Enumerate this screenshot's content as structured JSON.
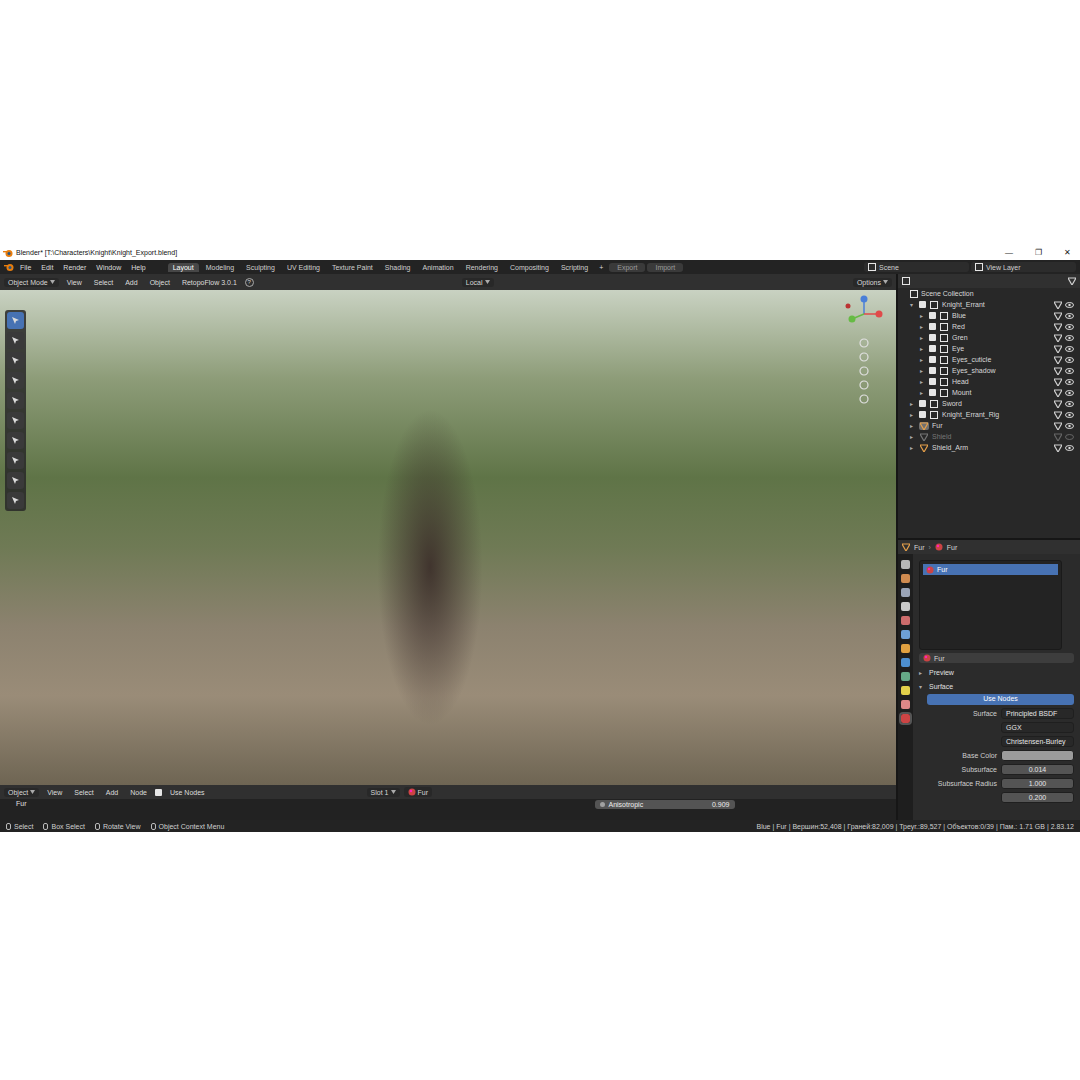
{
  "window": {
    "title": "Blender* [T:\\Characters\\Knight\\Knight_Export.blend]",
    "controls": [
      "—",
      "❐",
      "✕"
    ]
  },
  "menu": [
    "File",
    "Edit",
    "Render",
    "Window",
    "Help"
  ],
  "workspaces": [
    {
      "label": "Layout",
      "selected": true
    },
    {
      "label": "Modeling",
      "selected": false
    },
    {
      "label": "Sculpting",
      "selected": false
    },
    {
      "label": "UV Editing",
      "selected": false
    },
    {
      "label": "Texture Paint",
      "selected": false
    },
    {
      "label": "Shading",
      "selected": false
    },
    {
      "label": "Animation",
      "selected": false
    },
    {
      "label": "Rendering",
      "selected": false
    },
    {
      "label": "Compositing",
      "selected": false
    },
    {
      "label": "Scripting",
      "selected": false
    }
  ],
  "add_workspace": "+",
  "io_buttons": [
    "Export",
    "Import"
  ],
  "scene": "Scene",
  "view_layer": "View Layer",
  "viewport_header": {
    "mode": "Object Mode",
    "menus": [
      "View",
      "Select",
      "Add",
      "Object"
    ],
    "addon": "RetopoFlow 3.0.1",
    "help": "?",
    "orientation": "Local",
    "options": "Options"
  },
  "tools": [
    {
      "selected": true
    },
    {
      "selected": false
    },
    {
      "selected": false
    },
    {
      "selected": false
    },
    {
      "selected": false
    },
    {
      "selected": false
    },
    {
      "selected": false
    },
    {
      "selected": false
    },
    {
      "selected": false
    },
    {
      "selected": false
    }
  ],
  "outliner": {
    "root": "Scene Collection",
    "items": [
      {
        "name": "Knight_Errant",
        "depth": 0,
        "kind": "collection",
        "expanded": true,
        "visible": true,
        "selected": false
      },
      {
        "name": "Blue",
        "depth": 1,
        "kind": "collection",
        "expanded": false,
        "visible": true,
        "selected": false
      },
      {
        "name": "Red",
        "depth": 1,
        "kind": "collection",
        "expanded": false,
        "visible": true,
        "selected": false
      },
      {
        "name": "Gren",
        "depth": 1,
        "kind": "collection",
        "expanded": false,
        "visible": true,
        "selected": false
      },
      {
        "name": "Eye",
        "depth": 1,
        "kind": "collection",
        "expanded": false,
        "visible": true,
        "selected": false
      },
      {
        "name": "Eyes_cuticle",
        "depth": 1,
        "kind": "collection",
        "expanded": false,
        "visible": true,
        "selected": false
      },
      {
        "name": "Eyes_shadow",
        "depth": 1,
        "kind": "collection",
        "expanded": false,
        "visible": true,
        "selected": false
      },
      {
        "name": "Head",
        "depth": 1,
        "kind": "collection",
        "expanded": false,
        "visible": true,
        "selected": false
      },
      {
        "name": "Mount",
        "depth": 1,
        "kind": "collection",
        "expanded": false,
        "visible": true,
        "selected": false
      },
      {
        "name": "Sword",
        "depth": 0,
        "kind": "collection",
        "expanded": false,
        "visible": true,
        "selected": false
      },
      {
        "name": "Knight_Errant_Rig",
        "depth": 0,
        "kind": "collection",
        "expanded": false,
        "visible": true,
        "selected": false
      },
      {
        "name": "Fur",
        "depth": 0,
        "kind": "object",
        "expanded": false,
        "visible": true,
        "selected": true
      },
      {
        "name": "Shield",
        "depth": 0,
        "kind": "object",
        "expanded": false,
        "visible": false,
        "selected": false
      },
      {
        "name": "Shield_Arm",
        "depth": 0,
        "kind": "object",
        "expanded": false,
        "visible": true,
        "selected": false
      }
    ]
  },
  "properties": {
    "object": "Fur",
    "material": "Fur",
    "slots": [
      {
        "name": "Fur",
        "selected": true
      }
    ],
    "material_field": "Fur",
    "panels": [
      {
        "label": "Preview",
        "expanded": false
      },
      {
        "label": "Surface",
        "expanded": true
      }
    ],
    "use_nodes": "Use Nodes",
    "fields": [
      {
        "label": "Surface",
        "value": "Principled BSDF",
        "kind": "dropdown"
      },
      {
        "label": "",
        "value": "GGX",
        "kind": "dropdown"
      },
      {
        "label": "",
        "value": "Christensen-Burley",
        "kind": "dropdown"
      },
      {
        "label": "Base Color",
        "value": "",
        "kind": "color",
        "color": "#9b9b9b"
      },
      {
        "label": "Subsurface",
        "value": "0.014",
        "kind": "number"
      },
      {
        "label": "Subsurface Radius",
        "value": "1.000",
        "kind": "number"
      },
      {
        "label": "",
        "value": "0.200",
        "kind": "number"
      }
    ]
  },
  "shader_header": {
    "mode": "Object",
    "menus": [
      "View",
      "Select",
      "Add",
      "Node"
    ],
    "use_nodes": "Use Nodes",
    "slot": "Slot 1",
    "material": "Fur"
  },
  "node_editor": {
    "label": "Fur",
    "sockets": [
      {
        "label": "Anisotropic",
        "value": "0.909"
      }
    ]
  },
  "status_bar": {
    "hints": [
      "Select",
      "Box Select",
      "Rotate View",
      "Object Context Menu"
    ],
    "stats": "Blue | Fur | Вершин:52,408 | Граней:82,009 | Треуг.:89,527 | Объектов:0/39 | Пам.: 1.71 GB | 2.83.12"
  }
}
